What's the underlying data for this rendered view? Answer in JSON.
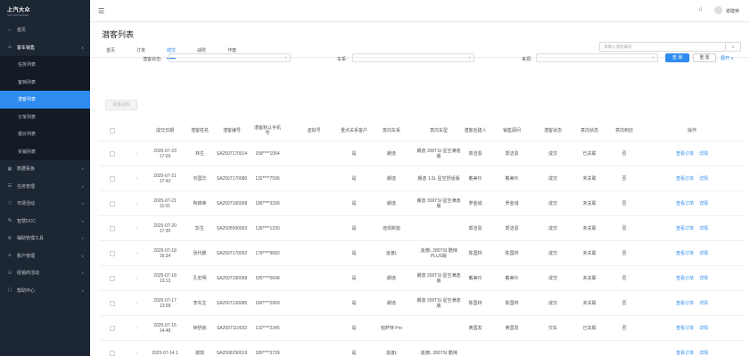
{
  "sidebar": {
    "logo": "上汽大众",
    "logo_sub": "SAIC VOLKSWAGEN",
    "items": [
      {
        "label": "首页",
        "icon": "home-icon",
        "glyph": "⌂",
        "chevron": false
      },
      {
        "label": "客车销售",
        "icon": "sales-icon",
        "glyph": "⚠",
        "chevron": true,
        "open": true
      },
      {
        "label": "数据看板",
        "icon": "dashboard-icon",
        "glyph": "▦",
        "chevron": true
      },
      {
        "label": "任务管理",
        "icon": "task-icon",
        "glyph": "☰",
        "chevron": true
      },
      {
        "label": "市场活动",
        "icon": "campaign-icon",
        "glyph": "▽",
        "chevron": true
      },
      {
        "label": "智慧DCC",
        "icon": "dcc-icon",
        "glyph": "%",
        "chevron": true
      },
      {
        "label": "辅助管理工具",
        "icon": "tools-icon",
        "glyph": "⚙",
        "chevron": true
      },
      {
        "label": "账户管理",
        "icon": "account-icon",
        "glyph": "♙",
        "chevron": true
      },
      {
        "label": "经销商活动",
        "icon": "dealer-icon",
        "glyph": "☷",
        "chevron": true
      },
      {
        "label": "帮助中心",
        "icon": "help-icon",
        "glyph": "▢",
        "chevron": true
      }
    ],
    "sub_items": [
      {
        "label": "任务列表",
        "active": false
      },
      {
        "label": "客档列表",
        "active": false
      },
      {
        "label": "潜客列表",
        "active": true
      },
      {
        "label": "订单列表",
        "active": false
      },
      {
        "label": "报价列表",
        "active": false
      },
      {
        "label": "实销列表",
        "active": false
      }
    ]
  },
  "header": {
    "user_name": "谢建荣"
  },
  "page": {
    "title": "潜客列表",
    "tabs": [
      {
        "label": "首页",
        "active": false
      },
      {
        "label": "订单",
        "active": false
      },
      {
        "label": "成交",
        "active": true
      },
      {
        "label": "战败",
        "active": false
      },
      {
        "label": "作废",
        "active": false
      }
    ],
    "search_placeholder": "请输入潜客编号"
  },
  "filters": {
    "labels": [
      "潜客状态:",
      "车系:",
      "来源:"
    ],
    "query_button": "查 询",
    "reset_button": "重 置",
    "expand_button": "展开 ∨",
    "batch_button": "批量战败"
  },
  "table": {
    "headers": [
      "成交日期",
      "潜客姓名",
      "潜客编号",
      "潜客默认手机号",
      "虚拟号",
      "重点关系客户",
      "意向车系",
      "意向车型",
      "潜客创建人",
      "销售顾问",
      "潜客状态",
      "意向状态",
      "意向到店",
      "操作"
    ],
    "rows": [
      {
        "date": "2025-07-23 17:05",
        "name": "林生",
        "id": "SA2507170014",
        "phone": "158****1054",
        "virtual": "",
        "key": "是",
        "series": "朗逸",
        "model": "朗逸 300TSI 星空满逸版",
        "creator": "郭洁恩",
        "advisor": "郭洁恩",
        "status": "成交",
        "intent": "已关联",
        "visit": "否",
        "actions": [
          "查看订单",
          "详情"
        ]
      },
      {
        "date": "2025-07-21 17:42",
        "name": "刘国华",
        "id": "SA2507170080",
        "phone": "132****7596",
        "virtual": "",
        "key": "是",
        "series": "朗逸",
        "model": "朗逸 1.5L 星空舒适版",
        "creator": "戴美玲",
        "advisor": "戴美玲",
        "status": "成交",
        "intent": "未关联",
        "visit": "否",
        "actions": [
          "查看订单",
          "详情"
        ]
      },
      {
        "date": "2025-07-21 11:01",
        "name": "陶锦荣",
        "id": "SA2507180008",
        "phone": "186****3290",
        "virtual": "",
        "key": "是",
        "series": "朗逸",
        "model": "朗逸 300TSI 星空满逸版",
        "creator": "罗金城",
        "advisor": "罗金城",
        "status": "成交",
        "intent": "未关联",
        "visit": "否",
        "actions": [
          "查看订单",
          "详情"
        ]
      },
      {
        "date": "2025-07-20 17:30",
        "name": "彭生",
        "id": "SA2505090063",
        "phone": "136****1230",
        "virtual": "",
        "key": "是",
        "series": "途观新能",
        "model": "",
        "creator": "郭洁恩",
        "advisor": "郭洁恩",
        "status": "成交",
        "intent": "未关联",
        "visit": "否",
        "actions": [
          "查看订单",
          "详情"
        ]
      },
      {
        "date": "2025-07-18 16:34",
        "name": "张代鹏",
        "id": "SA2507170052",
        "phone": "178****9683",
        "virtual": "",
        "key": "是",
        "series": "凌渡L",
        "model": "凌渡L 280TSI 酷辣PLUS版",
        "creator": "陈国林",
        "advisor": "陈国林",
        "status": "成交",
        "intent": "未关联",
        "visit": "否",
        "actions": [
          "查看订单",
          "详情"
        ]
      },
      {
        "date": "2025-07-18 13:13",
        "name": "孔宏明",
        "id": "SA2507180058",
        "phone": "185****0648",
        "virtual": "",
        "key": "是",
        "series": "朗逸",
        "model": "朗逸 300TSI 星空满逸版",
        "creator": "戴美玲",
        "advisor": "戴美玲",
        "status": "成交",
        "intent": "未关联",
        "visit": "否",
        "actions": [
          "查看订单",
          "详情"
        ]
      },
      {
        "date": "2025-07-17 13:58",
        "name": "李先生",
        "id": "SA2507130085",
        "phone": "166****2950",
        "virtual": "",
        "key": "是",
        "series": "朗逸",
        "model": "朗逸 300TSI 星空满逸版",
        "creator": "陈国林",
        "advisor": "陈国林",
        "status": "成交",
        "intent": "未关联",
        "visit": "否",
        "actions": [
          "查看订单",
          "详情"
        ]
      },
      {
        "date": "2025-07-15 14:48",
        "name": "钟舒航",
        "id": "SA2507110033",
        "phone": "132****2345",
        "virtual": "",
        "key": "是",
        "series": "帕萨特 Pro",
        "model": "",
        "creator": "黄国发",
        "advisor": "黄国发",
        "status": "交车",
        "intent": "已关联",
        "visit": "否",
        "actions": [
          "查看订单",
          "详情"
        ]
      },
      {
        "date": "2025-07-14 1",
        "name": "谢琪",
        "id": "SA2506290019",
        "phone": "189****3739",
        "virtual": "",
        "key": "是",
        "series": "凌渡L",
        "model": "凌渡L 280TSI 酷辣",
        "creator": "",
        "advisor": "",
        "status": "",
        "intent": "",
        "visit": "",
        "actions": [
          "查看订单",
          "详情"
        ]
      }
    ]
  }
}
